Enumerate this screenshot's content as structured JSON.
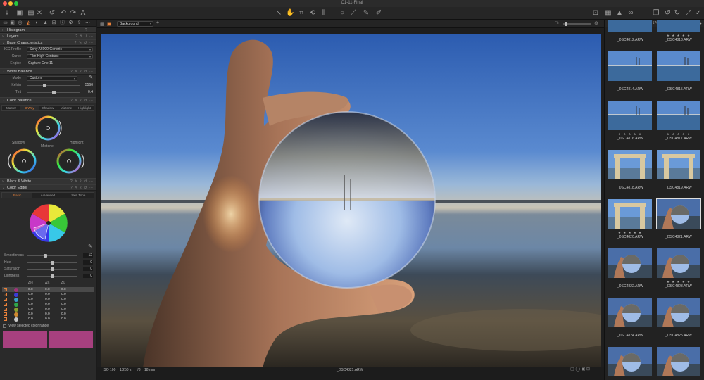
{
  "window": {
    "title": "C1-11-Final"
  },
  "toolbar": {
    "left_icons": [
      "import-icon",
      "camera-icon",
      "capture-icon",
      "delete-icon",
      "undo-history-icon",
      "undo-icon",
      "redo-icon",
      "text-icon"
    ],
    "center_icons": [
      "cursor-icon",
      "pan-icon",
      "crop-icon",
      "rotate-icon",
      "keystone-icon",
      "spot-icon",
      "picker-icon",
      "brush-icon",
      "annotate-icon"
    ],
    "right_icons": [
      "loupe-icon",
      "grid-icon",
      "warning-icon",
      "glasses-icon",
      "copy-icon",
      "rotate-left-icon",
      "rotate-right-icon",
      "brush-tool-icon",
      "apply-icon"
    ]
  },
  "left_panel": {
    "sections": {
      "histogram": "Histogram",
      "layers": "Layers",
      "base_characteristics": "Base Characteristics",
      "white_balance": "White Balance",
      "color_balance": "Color Balance",
      "black_white": "Black & White",
      "color_editor": "Color Editor"
    },
    "base": {
      "icc_label": "ICC Profile",
      "icc_value": "Sony A6000 Generic",
      "curve_label": "Curve",
      "curve_value": "Film High Contrast",
      "engine_label": "Engine",
      "engine_value": "Capture One 11"
    },
    "white_balance": {
      "mode_label": "Mode",
      "mode_value": "Custom",
      "kelvin_label": "Kelvin",
      "kelvin_value": "5560",
      "kelvin_pos": 0.33,
      "tint_label": "Tint",
      "tint_value": "0.4",
      "tint_pos": 0.5
    },
    "color_balance": {
      "tabs": [
        "Master",
        "3-Way",
        "Shadow",
        "Midtone",
        "Highlight"
      ],
      "active_tab": 1,
      "labels": {
        "shadow": "Shadow",
        "midtone": "Midtone",
        "highlight": "Highlight"
      }
    },
    "color_editor": {
      "tabs": [
        "Basic",
        "Advanced",
        "Skin Tone"
      ],
      "active_tab": 0,
      "sliders": [
        {
          "label": "Smoothness",
          "value": "12",
          "pos": 0.36
        },
        {
          "label": "Hue",
          "value": "0",
          "pos": 0.5
        },
        {
          "label": "Saturation",
          "value": "0",
          "pos": 0.5
        },
        {
          "label": "Lightness",
          "value": "0",
          "pos": 0.5
        }
      ],
      "table_headers": [
        "ΔH",
        "ΔS",
        "ΔL"
      ],
      "rows": [
        {
          "color": "#a0327a",
          "h": "0.0",
          "s": "0.0",
          "l": "0.0"
        },
        {
          "color": "#3b3bd8",
          "h": "0.0",
          "s": "0.0",
          "l": "0.0"
        },
        {
          "color": "#3aa0c8",
          "h": "0.0",
          "s": "0.0",
          "l": "0.0"
        },
        {
          "color": "#2ea84a",
          "h": "0.0",
          "s": "0.0",
          "l": "0.0"
        },
        {
          "color": "#8aa030",
          "h": "0.0",
          "s": "0.0",
          "l": "0.0"
        },
        {
          "color": "#d08a30",
          "h": "0.0",
          "s": "0.0",
          "l": "0.0"
        },
        {
          "color": "#c8c8c8",
          "h": "0.0",
          "s": "0.0",
          "l": "0.0"
        }
      ],
      "view_range_label": "View selected color range",
      "swatch_color": "#a7407f"
    }
  },
  "viewer": {
    "layer_select": "Background",
    "fit_label": "Fit",
    "info": {
      "iso": "ISO 100",
      "shutter": "1/250 s",
      "aperture": "f/8",
      "focal": "18 mm",
      "filename": "_DSC4821.ARW"
    }
  },
  "browser": {
    "counter": "1 of 176",
    "thumbs": [
      {
        "name": "_DSC4812.ARW",
        "stars": "",
        "kind": "sea"
      },
      {
        "name": "_DSC4813.ARW",
        "stars": "★ ★ ★ ★ ★",
        "kind": "sea"
      },
      {
        "name": "_DSC4814.ARW",
        "stars": "",
        "kind": "sea"
      },
      {
        "name": "_DSC4815.ARW",
        "stars": "",
        "kind": "sea"
      },
      {
        "name": "_DSC4816.ARW",
        "stars": "★ ★ ★ ★ ★",
        "kind": "sea"
      },
      {
        "name": "_DSC4817.ARW",
        "stars": "★ ★ ★ ★ ★",
        "kind": "sea"
      },
      {
        "name": "_DSC4818.ARW",
        "stars": "",
        "kind": "frame"
      },
      {
        "name": "_DSC4819.ARW",
        "stars": "",
        "kind": "frame"
      },
      {
        "name": "_DSC4820.ARW",
        "stars": "★ ★ ★ ★ ★",
        "kind": "frame"
      },
      {
        "name": "_DSC4821.ARW",
        "stars": "",
        "kind": "ball"
      },
      {
        "name": "_DSC4822.ARW",
        "stars": "",
        "kind": "ball"
      },
      {
        "name": "_DSC4823.ARW",
        "stars": "★ ★ ★ ★ ★",
        "kind": "ball"
      },
      {
        "name": "_DSC4824.ARW",
        "stars": "",
        "kind": "ball"
      },
      {
        "name": "_DSC4825.ARW",
        "stars": "",
        "kind": "ball"
      },
      {
        "name": "",
        "stars": "",
        "kind": "ball"
      },
      {
        "name": "",
        "stars": "",
        "kind": "ball"
      }
    ],
    "selected_index": 9
  }
}
